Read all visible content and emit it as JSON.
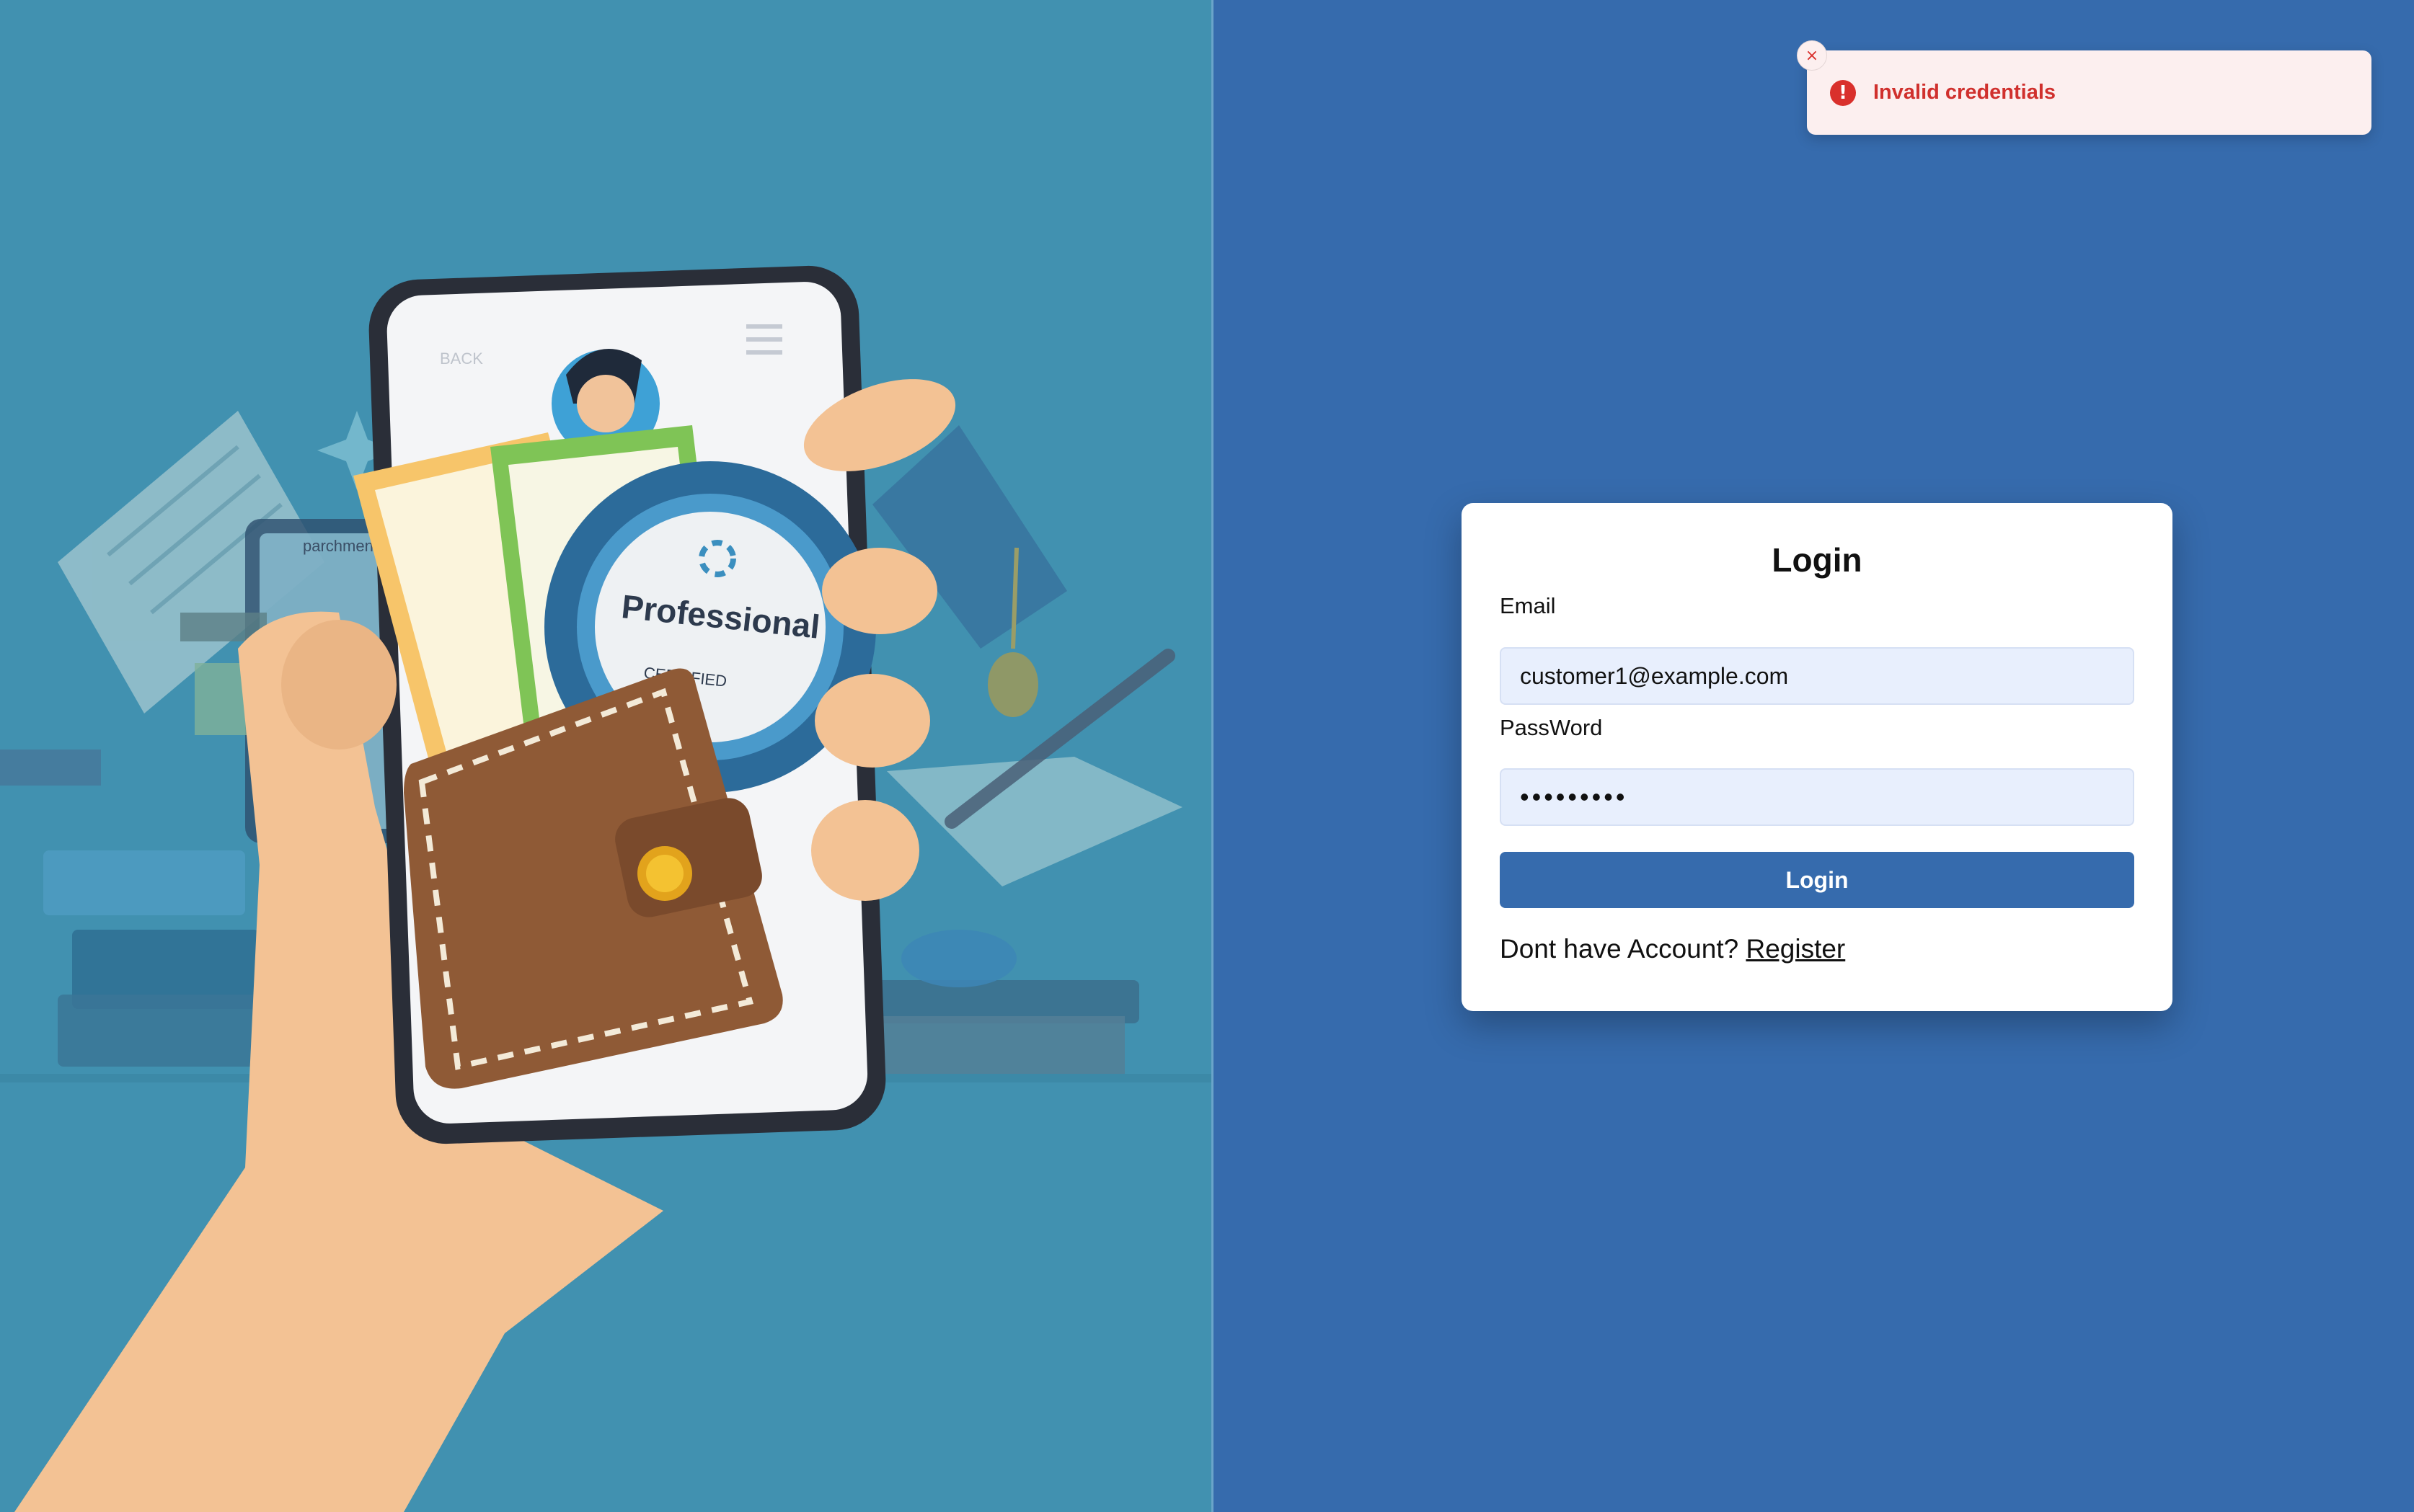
{
  "toast": {
    "message": "Invalid credentials",
    "icon": "error-circle-icon",
    "close_glyph": "×",
    "error_glyph": "!"
  },
  "illustration": {
    "badge_text": "Professional",
    "badge_subtext": "CERTIFIED",
    "phone_back_text": "BACK",
    "tablet_text": "parchment"
  },
  "login": {
    "title": "Login",
    "email_label": "Email",
    "email_value": "customer1@example.com",
    "password_label": "PassWord",
    "password_masked": "•••••••••",
    "submit_label": "Login",
    "signup_prompt": "Dont have Account?",
    "register_link": "Register"
  },
  "colors": {
    "left_bg": "#4191b0",
    "right_bg": "#366bad",
    "button": "#366bad",
    "input_bg": "#e8effd",
    "error": "#d0302d",
    "toast_bg": "#fcefef"
  }
}
